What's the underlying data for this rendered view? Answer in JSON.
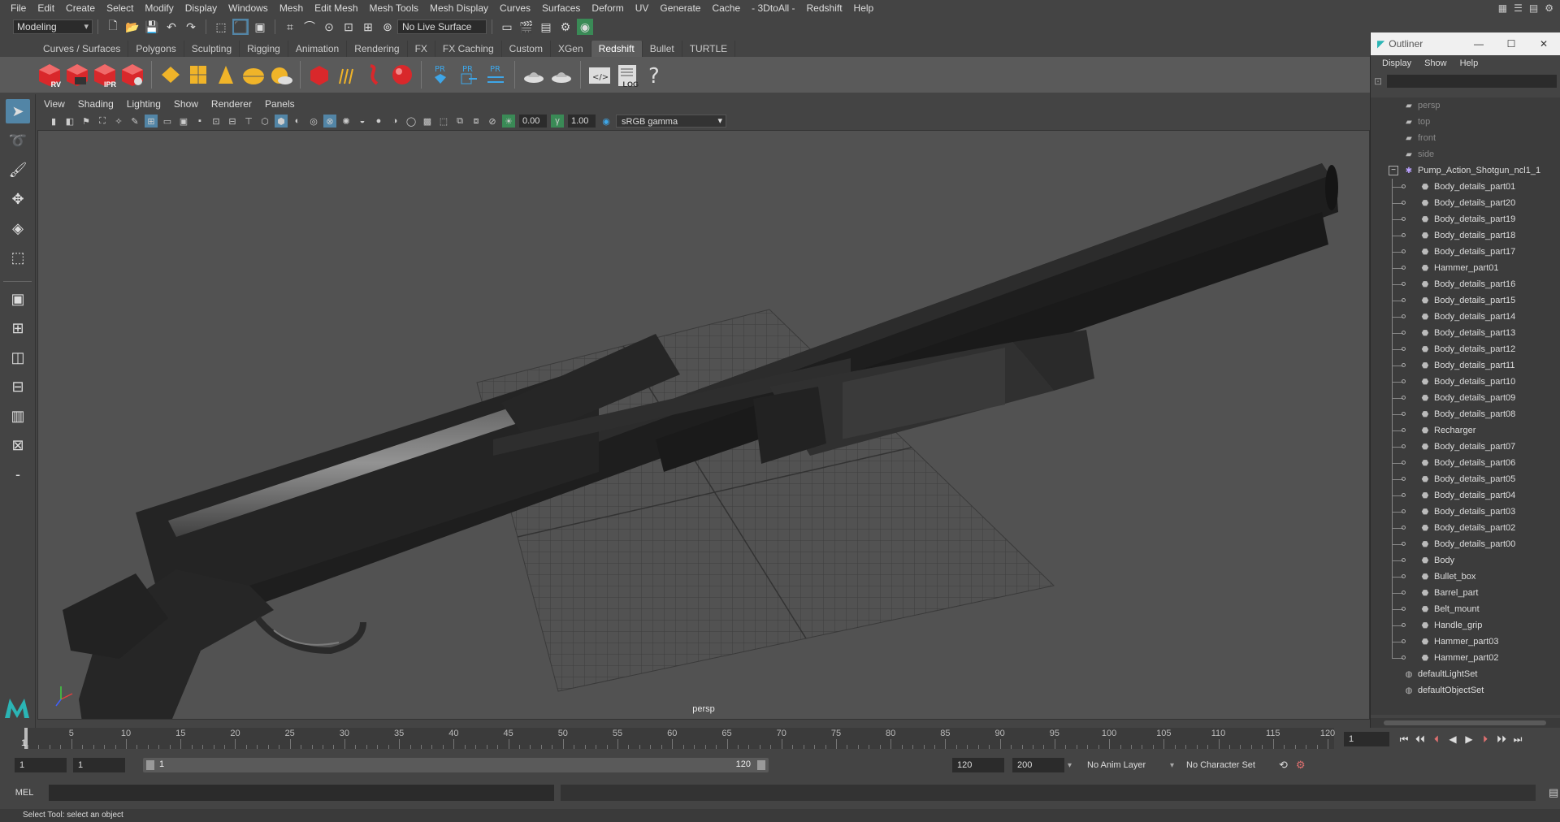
{
  "menubar": {
    "items": [
      "File",
      "Edit",
      "Create",
      "Select",
      "Modify",
      "Display",
      "Windows",
      "Mesh",
      "Edit Mesh",
      "Mesh Tools",
      "Mesh Display",
      "Curves",
      "Surfaces",
      "Deform",
      "UV",
      "Generate",
      "Cache",
      "- 3DtoAll -",
      "Redshift",
      "Help"
    ]
  },
  "statusline": {
    "mode": "Modeling",
    "live_surface": "No Live Surface"
  },
  "shelf": {
    "tabs": [
      "Curves / Surfaces",
      "Polygons",
      "Sculpting",
      "Rigging",
      "Animation",
      "Rendering",
      "FX",
      "FX Caching",
      "Custom",
      "XGen",
      "Redshift",
      "Bullet",
      "TURTLE"
    ],
    "active_tab": "Redshift",
    "button_labels": {
      "rv": "RV",
      "ipr": "IPR",
      "pr": "PR",
      "log": "LOG"
    },
    "colors": {
      "redshift_red": "#d9282b",
      "accent_yellow": "#f0b429",
      "pr_blue": "#3ea6e8"
    }
  },
  "viewport": {
    "menu": [
      "View",
      "Shading",
      "Lighting",
      "Show",
      "Renderer",
      "Panels"
    ],
    "exposure": "0.00",
    "gamma": "1.00",
    "color_space": "sRGB gamma",
    "camera": "persp"
  },
  "outliner": {
    "title": "Outliner",
    "menu": [
      "Display",
      "Show",
      "Help"
    ],
    "cameras": [
      "persp",
      "top",
      "front",
      "side"
    ],
    "root": "Pump_Action_Shotgun_ncl1_1",
    "children": [
      "Body_details_part01",
      "Body_details_part20",
      "Body_details_part19",
      "Body_details_part18",
      "Body_details_part17",
      "Hammer_part01",
      "Body_details_part16",
      "Body_details_part15",
      "Body_details_part14",
      "Body_details_part13",
      "Body_details_part12",
      "Body_details_part11",
      "Body_details_part10",
      "Body_details_part09",
      "Body_details_part08",
      "Recharger",
      "Body_details_part07",
      "Body_details_part06",
      "Body_details_part05",
      "Body_details_part04",
      "Body_details_part03",
      "Body_details_part02",
      "Body_details_part00",
      "Body",
      "Bullet_box",
      "Barrel_part",
      "Belt_mount",
      "Handle_grip",
      "Hammer_part03",
      "Hammer_part02"
    ],
    "sets": [
      "defaultLightSet",
      "defaultObjectSet"
    ]
  },
  "timeslider": {
    "ticks": [
      "5",
      "10",
      "15",
      "20",
      "25",
      "30",
      "35",
      "40",
      "45",
      "50",
      "55",
      "60",
      "65",
      "70",
      "75",
      "80",
      "85",
      "90",
      "95",
      "100",
      "105",
      "110",
      "115",
      "120"
    ],
    "current_frame": "1",
    "current_frame_field": "1"
  },
  "rangeslider": {
    "start": "1",
    "playback_start": "1",
    "range_start_label": "1",
    "range_end_label": "120",
    "playback_end": "120",
    "end": "200",
    "anim_layer": "No Anim Layer",
    "character_set": "No Character Set"
  },
  "cmdline": {
    "label": "MEL"
  },
  "helpline": {
    "text": "Select Tool: select an object"
  }
}
